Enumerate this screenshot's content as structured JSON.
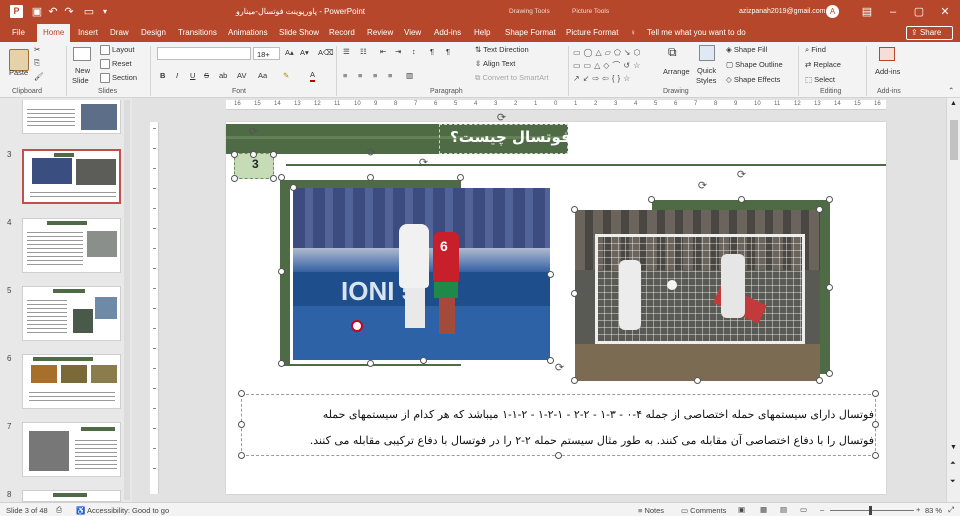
{
  "window": {
    "title": "پاورپوینت فوتسال-مینارو  -  PowerPoint",
    "context_tools": [
      "Drawing Tools",
      "Picture Tools"
    ],
    "user": "azizpanah2019@gmail.com",
    "user_initial": "A",
    "share_label": "Share"
  },
  "tabs": [
    "File",
    "Home",
    "Insert",
    "Draw",
    "Design",
    "Transitions",
    "Animations",
    "Slide Show",
    "Record",
    "Review",
    "View",
    "Add-ins",
    "Help",
    "Shape Format",
    "Picture Format"
  ],
  "active_tab": "Home",
  "tell_me": "Tell me what you want to do",
  "ribbon": {
    "clipboard": {
      "paste": "Paste",
      "label": "Clipboard"
    },
    "slides": {
      "new_slide": "New",
      "new_slide2": "Slide",
      "layout": "Layout",
      "reset": "Reset",
      "section": "Section",
      "label": "Slides"
    },
    "font": {
      "size": "18+",
      "label": "Font",
      "bold": "B",
      "italic": "I",
      "underline": "U",
      "strike": "S",
      "shadow": "ab",
      "spacing": "AV",
      "case": "Aa",
      "color": "A"
    },
    "paragraph": {
      "text_direction": "Text Direction",
      "align_text": "Align Text",
      "smartart": "Convert to SmartArt",
      "label": "Paragraph"
    },
    "drawing": {
      "arrange": "Arrange",
      "quick_styles": "Quick",
      "quick_styles2": "Styles",
      "fill": "Shape Fill",
      "outline": "Shape Outline",
      "effects": "Shape Effects",
      "label": "Drawing"
    },
    "editing": {
      "find": "Find",
      "replace": "Replace",
      "select": "Select",
      "label": "Editing"
    },
    "addins": {
      "button": "Add-ins",
      "label": "Add-ins"
    }
  },
  "thumbnails": [
    {
      "num": "3",
      "selected": true
    },
    {
      "num": "4",
      "selected": false
    },
    {
      "num": "5",
      "selected": false
    },
    {
      "num": "6",
      "selected": false
    },
    {
      "num": "7",
      "selected": false
    },
    {
      "num": "8",
      "selected": false
    }
  ],
  "ruler_ticks": [
    "16",
    "15",
    "14",
    "13",
    "12",
    "11",
    "10",
    "9",
    "8",
    "7",
    "6",
    "5",
    "4",
    "3",
    "2",
    "1",
    "0",
    "1",
    "2",
    "3",
    "4",
    "5",
    "6",
    "7",
    "8",
    "9",
    "10",
    "11",
    "12",
    "13",
    "14",
    "15",
    "16"
  ],
  "slide": {
    "title": "فوتسال چیست؟",
    "page_number": "3",
    "photo1_text": "IONI 5",
    "player_number": "6",
    "body_line1": "فوتسال دارای سیستمهای حمله اختصاصی از جمله ۴-۰ - ۳-۱ - ۲-۲ - ۱-۲-۱ - ۲-۱-۱ میباشد که هر کدام از سیستمهای حمله",
    "body_line2": "فوتسال را با دفاع اختصاصی آن مقابله می کنند. به طور مثال سیستم حمله ۲-۲ را در فوتسال با دفاع ترکیبی مقابله می کنند."
  },
  "colors": {
    "brand": "#b7472a",
    "slide_green": "#4e6b45",
    "light_green": "#c5dcb6"
  },
  "status": {
    "slide_of": "Slide 3 of 48",
    "accessibility": "Accessibility: Good to go",
    "notes": "Notes",
    "comments": "Comments",
    "zoom": "83 %"
  }
}
